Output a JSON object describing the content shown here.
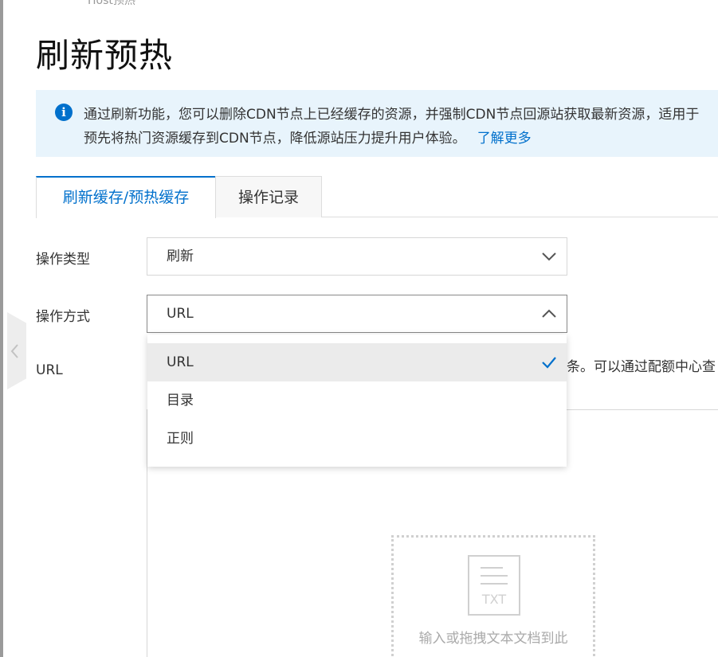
{
  "breadcrumb_cut": "Host预热",
  "page": {
    "title": "刷新预热"
  },
  "notice": {
    "line1": "通过刷新功能，您可以删除CDN节点上已经缓存的资源，并强制CDN节点回源站获取最新资源，适用于",
    "line2": "预先将热门资源缓存到CDN节点，降低源站压力提升用户体验。",
    "link": "了解更多"
  },
  "tabs": [
    {
      "label": "刷新缓存/预热缓存",
      "active": true
    },
    {
      "label": "操作记录",
      "active": false
    }
  ],
  "form": {
    "op_type": {
      "label": "操作类型",
      "value": "刷新"
    },
    "op_method": {
      "label": "操作方式",
      "value": "URL",
      "options": [
        {
          "label": "URL",
          "selected": true
        },
        {
          "label": "目录",
          "selected": false
        },
        {
          "label": "正则",
          "selected": false
        }
      ]
    },
    "url": {
      "label": "URL",
      "quota_hint": "条。可以通过配额中心查",
      "drop_text": "输入或拖拽文本文档到此",
      "txt_label": "TXT"
    }
  },
  "icons": {
    "info": "info-circle-icon",
    "chevron_down": "chevron-down-icon",
    "chevron_up": "chevron-up-icon",
    "check": "check-icon",
    "collapse": "chevron-left-icon",
    "txt_file": "txt-file-icon"
  },
  "colors": {
    "accent": "#0070cc",
    "notice_bg": "#e8f4fc",
    "selected_bg": "#ebebeb"
  }
}
